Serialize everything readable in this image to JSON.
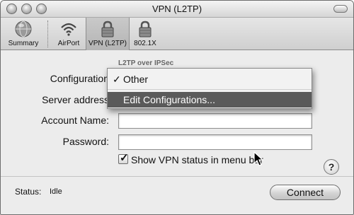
{
  "window": {
    "title": "VPN (L2TP)"
  },
  "toolbar": {
    "items": [
      {
        "label": "Summary",
        "icon": "globe-icon"
      },
      {
        "label": "AirPort",
        "icon": "wifi-icon"
      },
      {
        "label": "VPN (L2TP)",
        "icon": "lock-icon",
        "selected": true
      },
      {
        "label": "802.1X",
        "icon": "lock-icon"
      }
    ]
  },
  "form": {
    "sublabel": "L2TP over IPSec",
    "configuration_label": "Configuration",
    "server_address_label": "Server address",
    "account_name_label": "Account Name:",
    "password_label": "Password:",
    "show_status_label": "Show VPN status in menu bar",
    "show_status_checked": true
  },
  "configuration_menu": {
    "items": [
      {
        "label": "Other",
        "checked": true,
        "highlighted": false
      },
      {
        "label": "Edit Configurations...",
        "checked": false,
        "highlighted": true
      }
    ]
  },
  "help": {
    "label": "?"
  },
  "status": {
    "label": "Status:",
    "value": "Idle"
  },
  "connect": {
    "label": "Connect"
  },
  "colors": {
    "menu_highlight": "#5a5a5a",
    "window_background": "#ececec"
  }
}
